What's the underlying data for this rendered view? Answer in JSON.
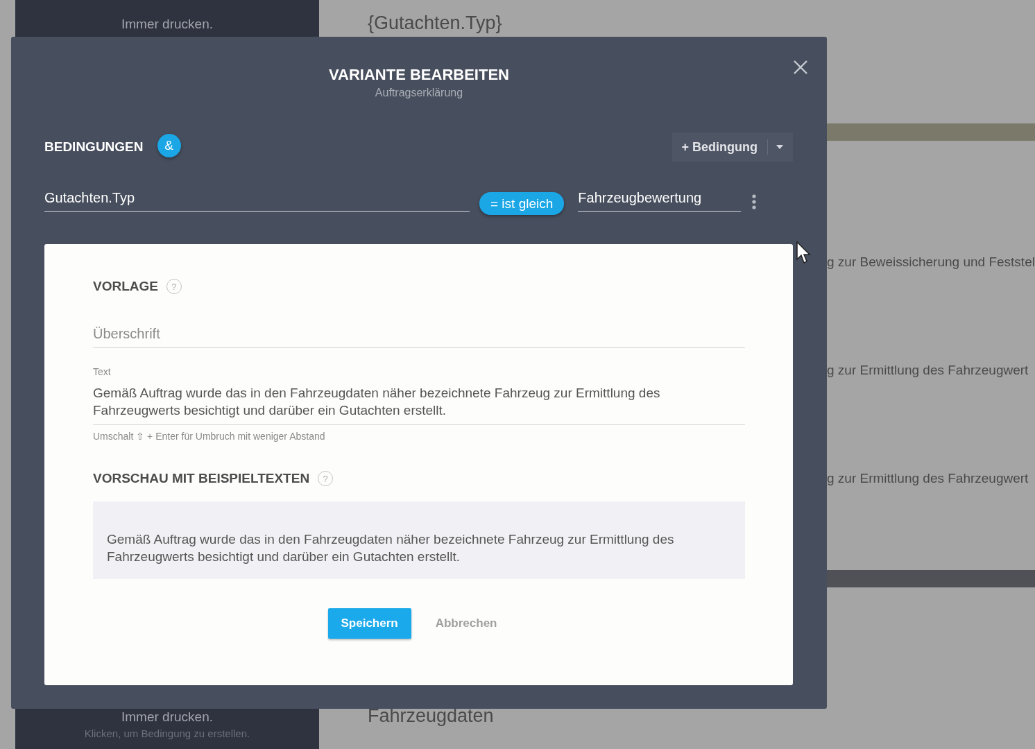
{
  "background": {
    "sidebar": {
      "top_item": {
        "title": "Immer drucken."
      },
      "bottom_item": {
        "title": "Immer drucken.",
        "hint": "Klicken, um Bedingung zu erstellen."
      }
    },
    "main": {
      "heading": "{Gutachten.Typ}",
      "rows": [
        "g zur Beweissicherung und Feststel",
        "g zur Ermittlung des Fahrzeugwert",
        "g zur Ermittlung des Fahrzeugwert"
      ],
      "footer_heading": "Fahrzeugdaten"
    }
  },
  "dialog": {
    "title": "VARIANTE BEARBEITEN",
    "subtitle": "Auftragserklärung",
    "conditions": {
      "heading": "BEDINGUNGEN",
      "join": "&",
      "add_button": "+ Bedingung",
      "rows": [
        {
          "field": "Gutachten.Typ",
          "operator": "= ist gleich",
          "value": "Fahrzeugbewertung"
        }
      ]
    },
    "template": {
      "heading": "VORLAGE",
      "help": "?",
      "heading_field": {
        "placeholder": "Überschrift"
      },
      "text_field": {
        "label": "Text",
        "value": "Gemäß Auftrag wurde das in den Fahrzeugdaten näher bezeichnete Fahrzeug zur Ermittlung des Fahrzeugwerts besichtigt und darüber ein Gutachten erstellt.",
        "hint": "Umschalt ⇧ + Enter für Umbruch mit weniger Abstand"
      }
    },
    "preview": {
      "heading": "VORSCHAU MIT BEISPIELTEXTEN",
      "help": "?",
      "text": "Gemäß Auftrag wurde das in den Fahrzeugdaten näher bezeichnete Fahrzeug zur Ermittlung des Fahrzeugwerts besichtigt und darüber ein Gutachten erstellt."
    },
    "buttons": [
      {
        "label": "Speichern",
        "kind": "primary"
      },
      {
        "label": "Abbrechen",
        "kind": "secondary"
      }
    ]
  }
}
